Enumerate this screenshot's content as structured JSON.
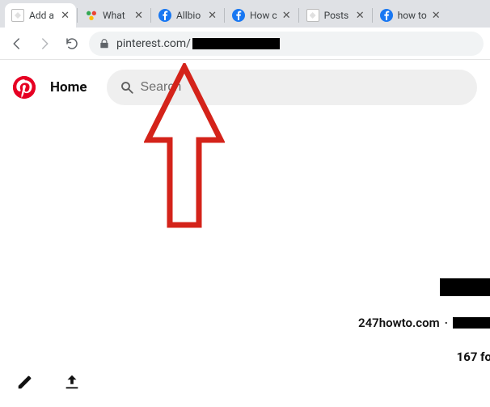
{
  "browser": {
    "tabs": [
      {
        "title": "Add a",
        "icon": "generic"
      },
      {
        "title": "What",
        "icon": "dots"
      },
      {
        "title": "Allbio",
        "icon": "facebook"
      },
      {
        "title": "How c",
        "icon": "facebook"
      },
      {
        "title": "Posts",
        "icon": "generic"
      },
      {
        "title": "how to",
        "icon": "facebook"
      }
    ],
    "url_visible": "pinterest.com/"
  },
  "page": {
    "home_label": "Home",
    "search_placeholder": "Search",
    "profile_domain": "247howto.com",
    "profile_separator": "·",
    "followers_fragment": "167 fo"
  }
}
